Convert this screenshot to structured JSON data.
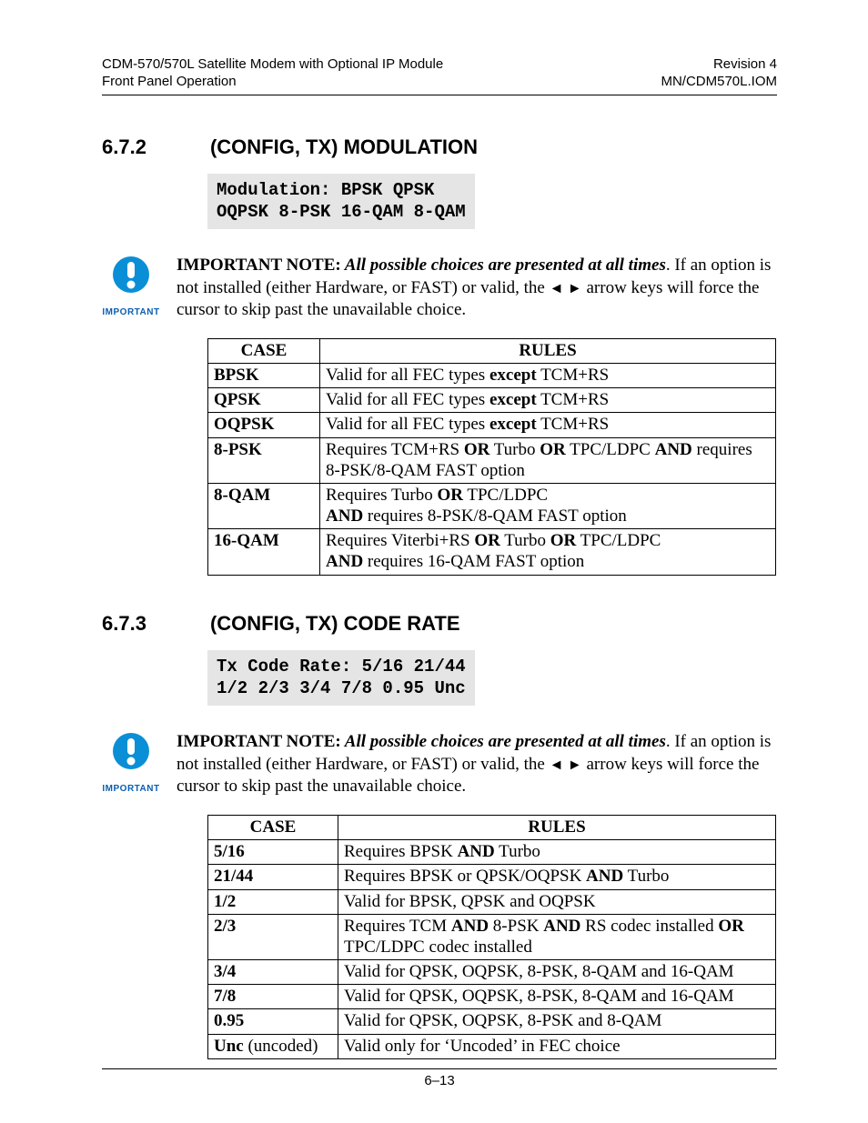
{
  "header": {
    "left1": "CDM-570/570L Satellite Modem with Optional IP Module",
    "left2": "Front Panel Operation",
    "right1": "Revision 4",
    "right2": "MN/CDM570L.IOM"
  },
  "section1": {
    "num": "6.7.2",
    "title": "(CONFIG, TX)  MODULATION",
    "code_l1": "Modulation: BPSK QPSK",
    "code_l2": "OQPSK 8-PSK 16-QAM 8-QAM",
    "note_lead": "IMPORTANT NOTE:",
    "note_em": " All possible choices are presented at all times",
    "note_rest1": ". If an option is not installed (either Hardware, or FAST) or valid, the ",
    "note_arrows": "◄ ►",
    "note_rest2": "  arrow keys  will force the cursor to skip past the unavailable choice.",
    "th_case": "CASE",
    "th_rules": "RULES",
    "rows": [
      {
        "case": "BPSK",
        "parts": [
          [
            "",
            "Valid for all FEC types "
          ],
          [
            "b",
            "except"
          ],
          [
            "",
            " TCM+RS"
          ]
        ]
      },
      {
        "case": "QPSK",
        "parts": [
          [
            "",
            "Valid for all FEC types "
          ],
          [
            "b",
            "except"
          ],
          [
            "",
            " TCM+RS"
          ]
        ]
      },
      {
        "case": "OQPSK",
        "parts": [
          [
            "",
            "Valid for all FEC types "
          ],
          [
            "b",
            "except"
          ],
          [
            "",
            " TCM+RS"
          ]
        ]
      },
      {
        "case": "8-PSK",
        "parts": [
          [
            "",
            "Requires TCM+RS "
          ],
          [
            "b",
            "OR"
          ],
          [
            "",
            " Turbo "
          ],
          [
            "b",
            "OR"
          ],
          [
            "",
            " TPC/LDPC "
          ],
          [
            "b",
            "AND"
          ],
          [
            "",
            " requires 8-PSK/8-QAM FAST option"
          ]
        ]
      },
      {
        "case": "8-QAM",
        "parts": [
          [
            "",
            "Requires Turbo "
          ],
          [
            "b",
            "OR"
          ],
          [
            "",
            " TPC/LDPC"
          ],
          [
            "br",
            ""
          ],
          [
            "b",
            "AND"
          ],
          [
            "",
            " requires 8-PSK/8-QAM FAST option"
          ]
        ]
      },
      {
        "case": "16-QAM",
        "parts": [
          [
            "",
            "Requires Viterbi+RS "
          ],
          [
            "b",
            "OR"
          ],
          [
            "",
            " Turbo "
          ],
          [
            "b",
            "OR"
          ],
          [
            "",
            " TPC/LDPC"
          ],
          [
            "br",
            ""
          ],
          [
            "b",
            "AND"
          ],
          [
            "",
            " requires 16-QAM FAST option"
          ]
        ]
      }
    ]
  },
  "section2": {
    "num": "6.7.3",
    "title": "(CONFIG, TX)  CODE RATE",
    "code_l1": "Tx Code Rate: 5/16 21/44",
    "code_l2": "1/2 2/3 3/4 7/8 0.95 Unc",
    "note_lead": "IMPORTANT NOTE:",
    "note_em": " All possible choices are presented at all times",
    "note_rest1": ". If an option is not installed (either Hardware, or FAST) or valid, the ",
    "note_arrows": "◄ ►",
    "note_rest2": "  arrow keys  will force the cursor to skip past the unavailable choice.",
    "th_case": "CASE",
    "th_rules": "RULES",
    "rows": [
      {
        "case": "5/16",
        "case_extra": "",
        "parts": [
          [
            "",
            "Requires BPSK "
          ],
          [
            "b",
            "AND"
          ],
          [
            "",
            " Turbo"
          ]
        ]
      },
      {
        "case": "21/44",
        "case_extra": "",
        "parts": [
          [
            "",
            "Requires BPSK or QPSK/OQPSK "
          ],
          [
            "b",
            "AND"
          ],
          [
            "",
            " Turbo"
          ]
        ]
      },
      {
        "case": "1/2",
        "case_extra": "",
        "parts": [
          [
            "",
            "Valid for BPSK, QPSK and OQPSK"
          ]
        ]
      },
      {
        "case": "2/3",
        "case_extra": "",
        "parts": [
          [
            "",
            "Requires TCM "
          ],
          [
            "b",
            "AND"
          ],
          [
            "",
            " 8-PSK "
          ],
          [
            "b",
            "AND"
          ],
          [
            "",
            " RS codec installed "
          ],
          [
            "b",
            "OR"
          ],
          [
            "",
            " TPC/LDPC codec installed"
          ]
        ]
      },
      {
        "case": "3/4",
        "case_extra": "",
        "parts": [
          [
            "",
            "Valid for QPSK, OQPSK, 8-PSK, 8-QAM and 16-QAM"
          ]
        ]
      },
      {
        "case": "7/8",
        "case_extra": "",
        "parts": [
          [
            "",
            "Valid for QPSK, OQPSK, 8-PSK, 8-QAM and 16-QAM"
          ]
        ]
      },
      {
        "case": "0.95",
        "case_extra": "",
        "parts": [
          [
            "",
            "Valid for QPSK, OQPSK, 8-PSK and 8-QAM"
          ]
        ]
      },
      {
        "case": "Unc",
        "case_extra": " (uncoded)",
        "parts": [
          [
            "",
            "Valid only for ‘Uncoded’ in FEC choice"
          ]
        ]
      }
    ]
  },
  "important_label": "IMPORTANT",
  "footer": "6–13"
}
